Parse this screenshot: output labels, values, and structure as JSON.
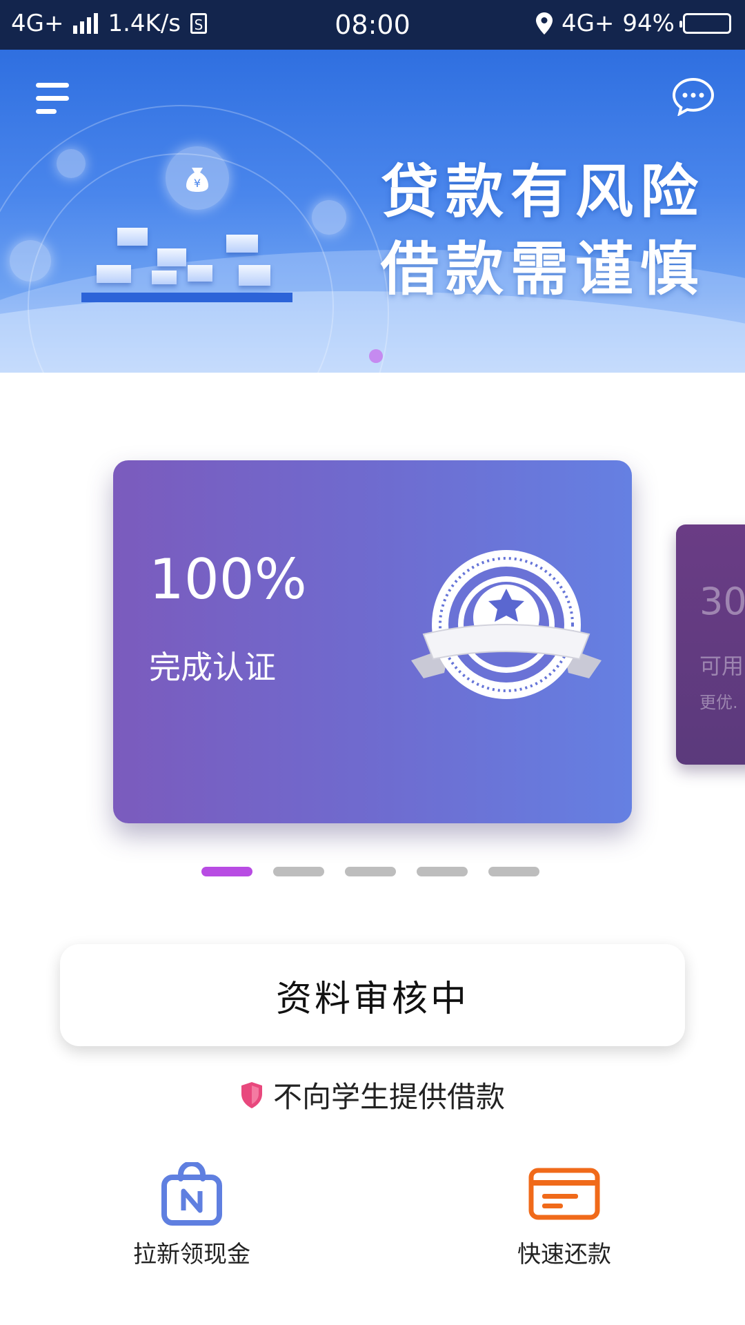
{
  "status_bar": {
    "network": "4G+",
    "speed": "1.4K/s",
    "sim_icon_label": "S",
    "time": "08:00",
    "network_right": "4G+",
    "battery_percent": "94%",
    "battery_level": 0.94
  },
  "banner": {
    "line1": "贷款有风险",
    "line2": "借款需谨慎",
    "currency_symbol": "¥"
  },
  "cards": [
    {
      "value": "100%",
      "label": "完成认证"
    },
    {
      "value": "30",
      "label": "可用",
      "sub": "更优."
    }
  ],
  "carousel": {
    "total": 5,
    "active_index": 0
  },
  "review_button": {
    "label": "资料审核中"
  },
  "notice": {
    "text": "不向学生提供借款"
  },
  "actions": [
    {
      "label": "拉新领现金",
      "icon": "shopping-bag-icon",
      "color": "#5f7fe0"
    },
    {
      "label": "快速还款",
      "icon": "card-icon",
      "color": "#f06a1a"
    }
  ],
  "colors": {
    "status_bar": "#13254d",
    "card_start": "#7b5bbd",
    "card_end": "#6580e2",
    "dot_active": "#b84ce3",
    "dot_inactive": "#bdbdbd"
  }
}
